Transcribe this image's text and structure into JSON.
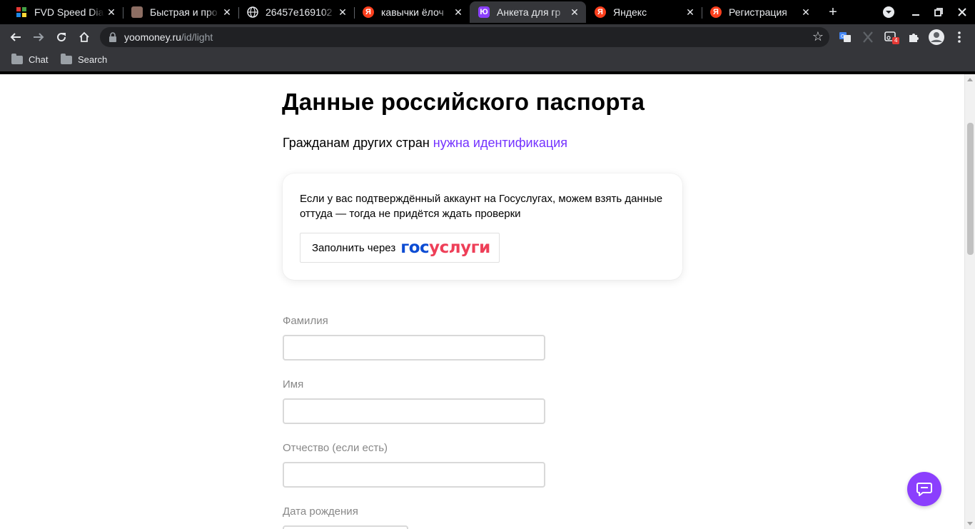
{
  "browser": {
    "tabs": [
      {
        "title": "FVD Speed Dial",
        "favicon": "fvd-speed-dial-icon",
        "active": false
      },
      {
        "title": "Быстрая и про",
        "favicon": "avatar-icon",
        "active": false
      },
      {
        "title": "26457e169102",
        "favicon": "globe-icon",
        "active": false
      },
      {
        "title": "кавычки ёлоч",
        "favicon": "yandex-icon",
        "active": false
      },
      {
        "title": "Анкета для гр",
        "favicon": "yoomoney-icon",
        "active": true
      },
      {
        "title": "Яндекс",
        "favicon": "yandex-icon",
        "active": false
      },
      {
        "title": "Регистрация",
        "favicon": "yandex-icon",
        "active": false
      }
    ],
    "address": {
      "host": "yoomoney.ru",
      "path": "/id/light"
    },
    "extension_badge": "4",
    "bookmarks": [
      {
        "label": "Chat"
      },
      {
        "label": "Search"
      }
    ],
    "favicon_letters": {
      "yandex": "Я",
      "yoomoney": "Ю"
    }
  },
  "page": {
    "title": "Данные российского паспорта",
    "subtitle_text": "Гражданам других стран ",
    "subtitle_link": "нужна идентификация",
    "gosuslugi_card": {
      "text": "Если у вас подтверждённый аккаунт на Госуслугах, можем взять данные оттуда — тогда не придётся ждать проверки",
      "button_label": "Заполнить через",
      "logo_part1": "гос",
      "logo_part2": "услуги"
    },
    "fields": [
      {
        "label": "Фамилия",
        "value": ""
      },
      {
        "label": "Имя",
        "value": ""
      },
      {
        "label": "Отчество (если есть)",
        "value": ""
      },
      {
        "label": "Дата рождения",
        "value": ""
      }
    ]
  },
  "colors": {
    "accent": "#7432ff",
    "chat_button": "#8b3ffd",
    "gos_blue": "#0d4cd3",
    "gos_red": "#ee3f58",
    "yandex": "#fc3f1d"
  }
}
